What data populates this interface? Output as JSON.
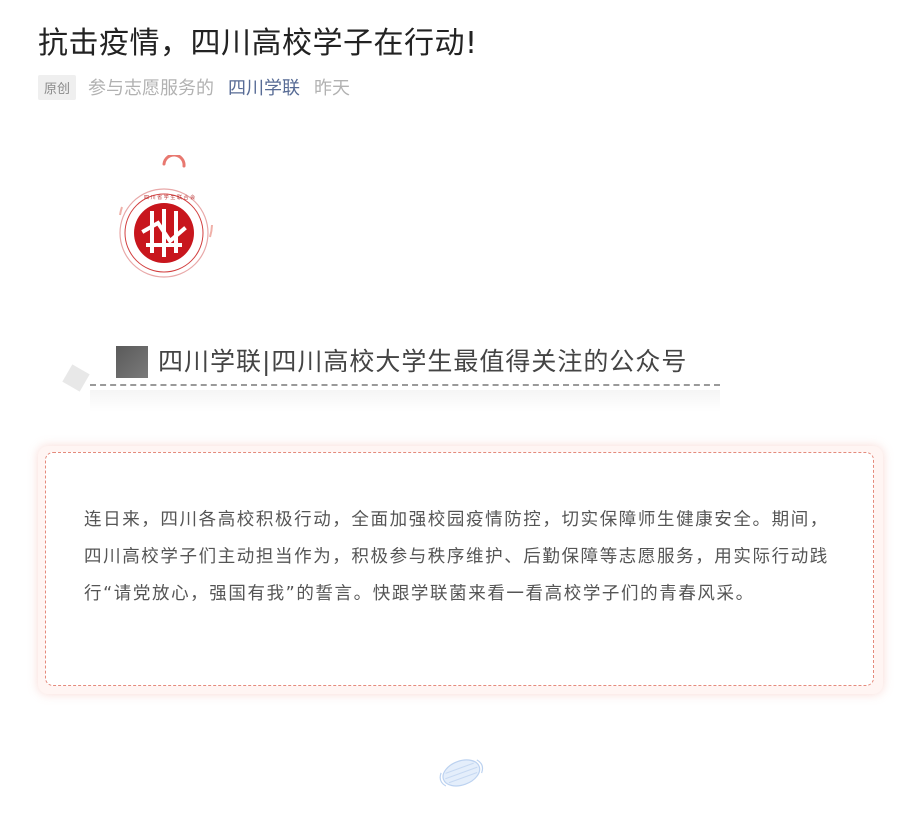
{
  "article": {
    "title": "抗击疫情，四川高校学子在行动!",
    "original_tag": "原创",
    "author": "参与志愿服务的",
    "account_name": "四川学联",
    "publish_time": "昨天"
  },
  "header_banner": {
    "logo_icon": "sichuan-student-federation-logo",
    "text": "四川学联|四川高校大学生最值得关注的公众号"
  },
  "intro": {
    "text": "连日来，四川各高校积极行动，全面加强校园疫情防控，切实保障师生健康安全。期间，四川高校学子们主动担当作为，积极参与秩序维护、后勤保障等志愿服务，用实际行动践行“请党放心，强国有我”的誓言。快跟学联菌来看一看高校学子们的青春风采。"
  },
  "colors": {
    "accent_link": "#576b95",
    "logo_red": "#c8161d",
    "box_border": "#e58a7c"
  }
}
